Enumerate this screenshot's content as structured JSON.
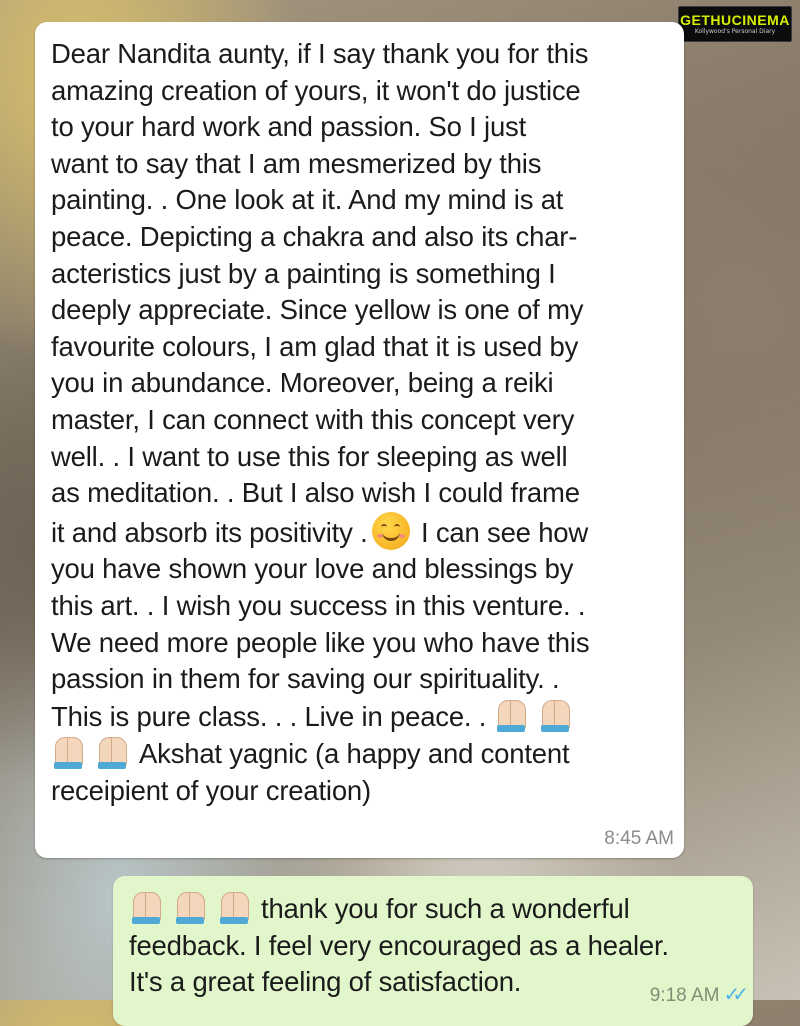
{
  "watermark": {
    "brand": "GETHUCINEMA",
    "tagline": "Kollywood's Personal Diary"
  },
  "incoming": {
    "lines_before_emoji": "Dear Nandita aunty, if I say thank you for this\namazing creation of yours, it won't do justice\nto your hard work and passion. So I just\nwant to say that I am mesmerized by this\npainting. . One look at it. And my mind is at\npeace. Depicting a chakra and also its char-\nacteristics just by a painting is something I\ndeeply appreciate. Since yellow is one of my\nfavourite colours, I am glad that it is used by\nyou in abundance. Moreover, being a reiki\nmaster, I can connect with this concept very\nwell. . I want to use this for sleeping as well\nas meditation. . But I also wish I could frame\nit and absorb its positivity .",
    "smile_emoji": "smiling-face-emoji",
    "after_emoji": "I can see how",
    "lines_middle": "you have shown your love and blessings by\nthis art. . I wish you success in this venture. .\nWe need more people like you who have this\npassion in them for saving our spirituality. .\nThis is pure class. . . Live in peace. .",
    "signature": "Akshat yagnic (a happy and content",
    "last_line": "receipient of your creation)",
    "time": "8:45 AM"
  },
  "outgoing": {
    "line1": "thank you for such a wonderful",
    "line2": "feedback. I feel very encouraged as a healer.",
    "line3": "It's a great feeling of satisfaction.",
    "time": "9:18 AM",
    "status_icon": "double-check-read"
  }
}
